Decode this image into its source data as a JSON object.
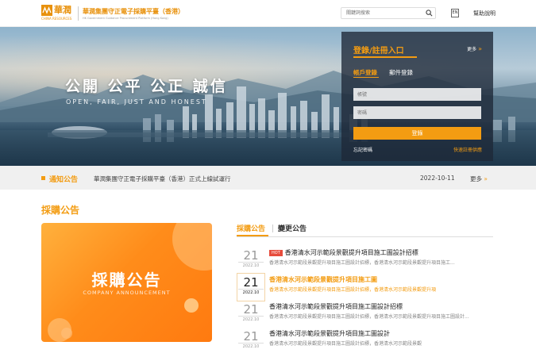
{
  "header": {
    "logo_name": "華潤",
    "logo_sub": "CHINA RESOURCES",
    "site_title": "華潤集團守正電子採購平臺（香港）",
    "site_subtitle": "HK Government Guidance Procurement Platform (Hong Kong)",
    "search_placeholder": "關鍵詞搜索",
    "lang_label": "EN",
    "help_label": "幫助說明"
  },
  "hero": {
    "slogan": "公開  公平  公正  誠信",
    "slogan_en": "OPEN, FAIR, JUST AND HONEST"
  },
  "login": {
    "title": "登錄/註冊入口",
    "more_label": "更多",
    "tab_account": "帳戶登錄",
    "tab_email": "郵件登錄",
    "account_placeholder": "帳號",
    "password_placeholder": "密碼",
    "submit_label": "登錄",
    "forgot_label": "忘記密碼",
    "register_label": "快速註冊供應"
  },
  "notice": {
    "label": "通知公告",
    "text": "華潤集團守正電子採購平臺（香港）正式上線試運行",
    "date": "2022-10-11",
    "more_label": "更多"
  },
  "section": {
    "title": "採購公告"
  },
  "promo": {
    "title": "採購公告",
    "subtitle": "COMPANY ANNOUNCEMENT"
  },
  "tabs": {
    "active": "採購公告",
    "other": "變更公告"
  },
  "list": [
    {
      "day": "21",
      "ym": "2022.10",
      "badge": "HOT",
      "title": "香港清水河示範段景觀提升項目施工圖設計招標",
      "desc": "香港清水河示範段景觀提升項目施工圖設計招標，香港清水河示範段景觀提升項目施工..."
    },
    {
      "day": "21",
      "ym": "2022.10",
      "badge": "",
      "title": "香港清水河示範段景觀提升項目施工圖",
      "desc": "香港清水河示範段景觀提升項目施工圖設計招標，香港清水河示範段景觀提升項"
    },
    {
      "day": "21",
      "ym": "2022.10",
      "badge": "",
      "title": "香港清水河示範段景觀提升項目施工圖設計招標",
      "desc": "香港清水河示範段景觀提升項目施工圖設計招標，香港清水河示範段景觀提升項目施工圖設計..."
    },
    {
      "day": "21",
      "ym": "2022.10",
      "badge": "",
      "title": "香港清水河示範段景觀提升項目施工圖設計",
      "desc": "香港清水河示範段景觀提升項目施工圖設計招標，香港清水河示範段景觀"
    }
  ],
  "colors": {
    "accent": "#f39c12",
    "hot": "#e74c3c"
  }
}
